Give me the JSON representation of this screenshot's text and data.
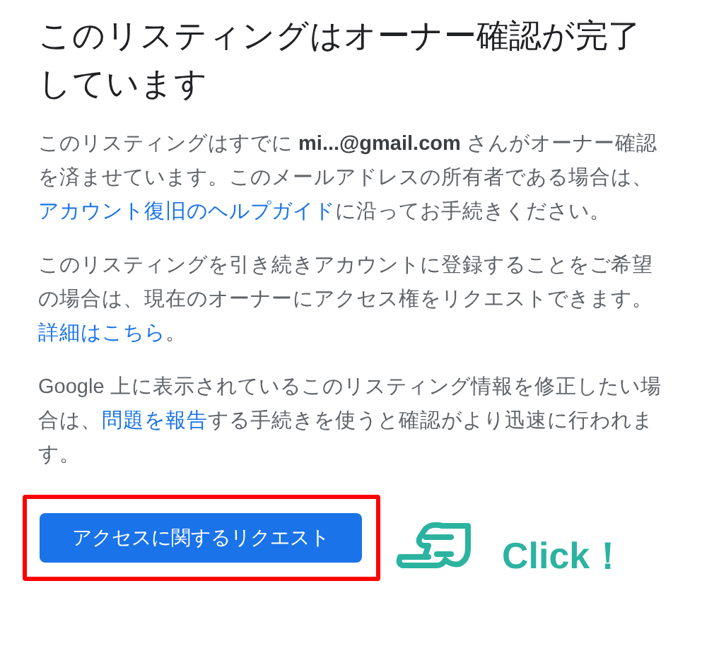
{
  "title": "このリスティングはオーナー確認が完了しています",
  "paragraphs": [
    [
      {
        "kind": "text",
        "text": "このリスティングはすでに "
      },
      {
        "kind": "bold",
        "text": "mi...@gmail.com"
      },
      {
        "kind": "text",
        "text": " さんがオーナー確認を済ませています。このメールアドレスの所有者である場合は、"
      },
      {
        "kind": "link",
        "text": "アカウント復旧のヘルプガイド"
      },
      {
        "kind": "text",
        "text": "に沿ってお手続きください。"
      }
    ],
    [
      {
        "kind": "text",
        "text": "このリスティングを引き続きアカウントに登録することをご希望の場合は、現在のオーナーにアクセス権をリクエストできます。"
      },
      {
        "kind": "link",
        "text": "詳細はこちら"
      },
      {
        "kind": "text",
        "text": "。"
      }
    ],
    [
      {
        "kind": "text",
        "text": "Google 上に表示されているこのリスティング情報を修正したい場合は、"
      },
      {
        "kind": "link",
        "text": "問題を報告"
      },
      {
        "kind": "text",
        "text": "する手続きを使うと確認がより迅速に行われます。"
      }
    ]
  ],
  "button": "アクセスに関するリクエスト",
  "annotation": {
    "highlighted": true,
    "label": "Click！"
  }
}
